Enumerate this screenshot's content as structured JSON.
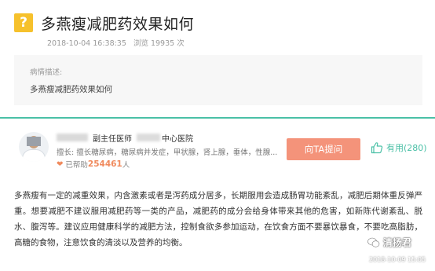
{
  "question": {
    "icon_glyph": "?",
    "title": "多燕瘦减肥药效果如何",
    "date": "2018-10-04 16:38:35",
    "views": "浏览 19935 次"
  },
  "description": {
    "label": "病情描述:",
    "text": "多燕瘦减肥药效果如何"
  },
  "doctor": {
    "title": "副主任医师",
    "hospital": "中心医院",
    "specialty": "擅长: 擅长糖尿病，糖尿病并发症，甲状腺，肾上腺，垂体，性腺...",
    "helped_prefix": "已帮助",
    "helped_count": "254461",
    "helped_suffix": "人",
    "ask_label": "向TA提问",
    "useful_label": "有用(280)"
  },
  "answer": {
    "text": "多燕瘦有一定的减重效果，内含激素或者是泻药成分居多，长期服用会造成肠胃功能紊乱，减肥后期体重反弹严重。想要减肥不建议服用减肥药等一类的产品，减肥药的成分会给身体带来其他的危害，如新陈代谢紊乱、脱水、腹泻等。建议应用健康科学的减肥方法，控制食欲多参加运动，在饮食方面不要暴饮暴食，不要吃高脂肪，高糖的食物，注意饮食的清淡以及营养的均衡。"
  },
  "watermark": {
    "name": "清扬君",
    "date": "2018-10-09 15:05"
  },
  "colors": {
    "accent_green": "#4ac0a6",
    "ask_button": "#f4937a",
    "question_icon": "#f6c12c",
    "helped_count": "#f08a5d"
  }
}
